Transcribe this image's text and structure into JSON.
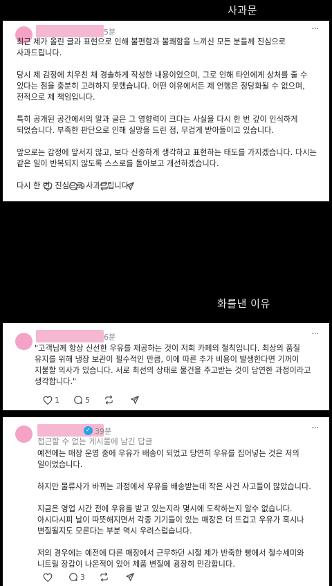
{
  "captions": {
    "top": "사과문",
    "middle": "화를낸 이유"
  },
  "card1": {
    "time": "5분",
    "more": "···",
    "text": "최근 제가 올린 글과 표현으로 인해 불편함과 불쾌함을 느끼신 모든 분들께 진심으로 사과드립니다.\n\n당시 제 감정에 치우친 채 경솔하게 작성한 내용이었으며, 그로 인해 타인에게 상처를 줄 수 있다는 점을 충분히 고려하지 못했습니다. 어떤 이유에서든 제 언행은 정당화될 수 없으며, 전적으로 제 책임입니다.\n\n특히 공개된 공간에서의 말과 글은 그 영향력이 크다는 사실을 다시 한 번 깊이 인식하게 되었습니다. 부족한 판단으로 인해 실망을 드린 점, 무겁게 받아들이고 있습니다.\n\n앞으로는 감정에 앞서지 않고, 보다 신중하게 생각하고 표현하는 태도를 가지겠습니다. 다시는 같은 일이 반복되지 않도록 스스로를 돌아보고 개선하겠습니다.\n\n다시 한 번, 진심으로 사과드립니다.",
    "counts": {
      "likes": "",
      "comments": "9",
      "reposts": ""
    }
  },
  "card2": {
    "time": "6분",
    "more": "···",
    "text": "\"고객님께 항상 신선한 우유를 제공하는 것이 저희 카페의 철칙입니다. 최상의 품질 유지를 위해 냉장 보관이 필수적인 만큼, 이에 따른 추가 비용이 발생한다면 기꺼이 지불할 의사가 있습니다. 서로 최선의 상태로 물건을 주고받는 것이 당연한 과정이라고 생각합니다.\"",
    "counts": {
      "likes": "1",
      "comments": "5",
      "reposts": ""
    }
  },
  "card3": {
    "time": "39분",
    "more": "···",
    "subtitle": "접근할 수 없는 게시물에 남긴 답글",
    "text": "예전에는 매장 운영 중에 우유가 배송이 되었고 당연히 우유를 집어넣는 것은 저의 일이었습니다.\n\n하지만 물류사가 바뀌는 과정에서 우유를 배송받는데 작은 사건 사고들이 많았습니다.\n\n지금은 영업 시간 전에 우유를 받고 있는지라 몇시에 도착하는지 알수 없습니다. 아시다시피 날이 따뜻해지면서 각종 기기들이 있는 매장은 더 뜨겁고 우유가 혹시나 변질될지도 모른다는 부분 역시 우려스럽습니다.\n\n저의 경우에는 예전에 다른 매장에서 근무하던 시절 제가 반죽한 빵에서 철수세미와 니트릴 장갑이 나온적이 있어 제품 변질에 굉장히 민감합니다.",
    "counts": {
      "likes": "",
      "comments": "3",
      "reposts": ""
    }
  },
  "icons": [
    "heart-icon",
    "comment-icon",
    "repost-icon",
    "share-icon",
    "verified-badge-icon"
  ],
  "colors": {
    "redaction": "#f6b7d2",
    "verified": "#2aa3e8",
    "background": "#000000"
  }
}
